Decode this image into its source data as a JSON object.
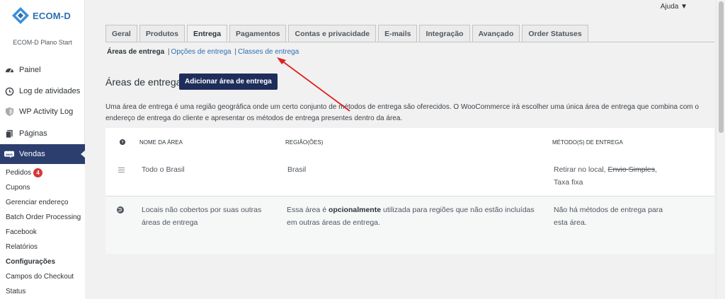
{
  "brand": {
    "name": "ECOM-D",
    "plan": "ECOM-D Plano Start"
  },
  "help": {
    "label": "Ajuda ▼"
  },
  "sidebar": {
    "items": [
      {
        "label": "Painel",
        "icon": "dashboard-icon"
      },
      {
        "label": "Log de atividades",
        "icon": "history-icon"
      },
      {
        "label": "WP Activity Log",
        "icon": "shield-icon"
      },
      {
        "label": "Páginas",
        "icon": "pages-icon"
      },
      {
        "label": "Vendas",
        "icon": "woo-icon"
      }
    ],
    "submenu": [
      {
        "label": "Pedidos",
        "badge": "4"
      },
      {
        "label": "Cupons"
      },
      {
        "label": "Gerenciar endereço"
      },
      {
        "label": "Batch Order Processing"
      },
      {
        "label": "Facebook"
      },
      {
        "label": "Relatórios"
      },
      {
        "label": "Configurações"
      },
      {
        "label": "Campos do Checkout"
      },
      {
        "label": "Status"
      }
    ]
  },
  "tabs": [
    "Geral",
    "Produtos",
    "Entrega",
    "Pagamentos",
    "Contas e privacidade",
    "E-mails",
    "Integração",
    "Avançado",
    "Order Statuses"
  ],
  "subnav": {
    "current": "Áreas de entrega",
    "sep": "|",
    "options": "Opções de entrega",
    "classes": "Classes de entrega"
  },
  "heading": "Áreas de entrega",
  "add_button": "Adicionar área de entrega",
  "description_line1": "Uma área de entrega é uma região geográfica onde um certo conjunto de métodos de entrega são oferecidos. O WooCommerce irá escolher uma única área de entrega que combina com o",
  "description_line2": "endereço de entrega do cliente e apresentar os métodos de entrega presentes dentro da área.",
  "table": {
    "headers": {
      "help": "?",
      "name": "Nome da área",
      "region": "Região(ões)",
      "methods": "Método(s) de entrega"
    },
    "row1": {
      "name": "Todo o Brasil",
      "region": "Brasil",
      "method_a": "Retirar no local",
      "method_b": "Envio Simples",
      "method_c": "Taxa fixa"
    },
    "row2": {
      "name_l1": "Locais não cobertos por suas outras",
      "name_l2": "áreas de entrega",
      "region_a": "Essa área é ",
      "region_b": "opcionalmente",
      "region_c": " utilizada para regiões que não estão incluídas",
      "region_l2": "em outras áreas de entrega.",
      "methods_l1": "Não há métodos de entrega para",
      "methods_l2": "esta área."
    }
  },
  "colors": {
    "accent": "#1e2d5a",
    "menu_active": "#2c3e6e",
    "link": "#2c6fb0",
    "arrow": "#e02020"
  }
}
